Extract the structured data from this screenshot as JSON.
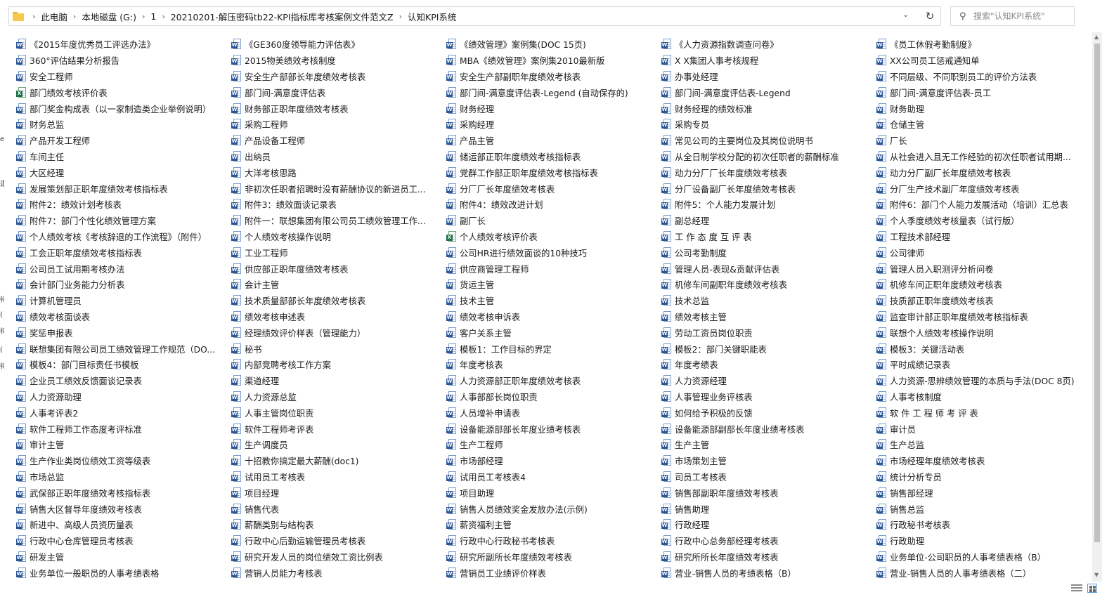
{
  "breadcrumb": [
    "此电脑",
    "本地磁盘 (G:)",
    "1",
    "20210201-解压密码tb22-KPI指标库考核案例文件范文Z",
    "认知KPI系统"
  ],
  "search": {
    "placeholder": "搜索\"认知KPI系统\""
  },
  "icons": {
    "folder": "folder-icon",
    "refresh": "refresh-icon",
    "search": "search-icon",
    "chevron": "chevron-down-icon"
  },
  "colors": {
    "word": "#2b5797",
    "excel": "#1e7145",
    "folder": "#f5c94e"
  },
  "left_strip": [
    "e",
    "退",
    "待",
    "(",
    "待",
    "(",
    "待"
  ],
  "files": [
    {
      "name": "《2015年度优秀员工评选办法》",
      "type": "doc"
    },
    {
      "name": "《GE360度领导能力评估表》",
      "type": "doc"
    },
    {
      "name": "《绩效管理》案例集(DOC 15页)",
      "type": "doc"
    },
    {
      "name": "《人力资源指数调查问卷》",
      "type": "doc"
    },
    {
      "name": "《员工休假考勤制度》",
      "type": "doc"
    },
    {
      "name": "360°评估结果分析报告",
      "type": "doc"
    },
    {
      "name": "2015物美绩效考核制度",
      "type": "doc"
    },
    {
      "name": "MBA《绩效管理》案例集2010最新版",
      "type": "doc"
    },
    {
      "name": "X X集团人事考核规程",
      "type": "doc"
    },
    {
      "name": "XX公司员工惩戒通知单",
      "type": "doc"
    },
    {
      "name": "安全工程师",
      "type": "doc"
    },
    {
      "name": "安全生产部部长年度绩效考核表",
      "type": "doc"
    },
    {
      "name": "安全生产部副职年度绩效考核表",
      "type": "doc"
    },
    {
      "name": "办事处经理",
      "type": "doc"
    },
    {
      "name": "不同层级、不同职别员工的评价方法表",
      "type": "doc"
    },
    {
      "name": "部门绩效考核评价表",
      "type": "xls"
    },
    {
      "name": "部门间-满意度评估表",
      "type": "doc"
    },
    {
      "name": "部门间-满意度评估表-Legend (自动保存的)",
      "type": "doc"
    },
    {
      "name": "部门间-满意度评估表-Legend",
      "type": "doc"
    },
    {
      "name": "部门间-满意度评估表-员工",
      "type": "doc"
    },
    {
      "name": "部门奖金构成表（以一家制造类企业举例说明）",
      "type": "doc"
    },
    {
      "name": "财务部正职年度绩效考核表",
      "type": "doc"
    },
    {
      "name": "财务经理",
      "type": "doc"
    },
    {
      "name": "财务经理的绩效标准",
      "type": "doc"
    },
    {
      "name": "财务助理",
      "type": "doc"
    },
    {
      "name": "财务总监",
      "type": "doc"
    },
    {
      "name": "采购工程师",
      "type": "doc"
    },
    {
      "name": "采购经理",
      "type": "doc"
    },
    {
      "name": "采购专员",
      "type": "doc"
    },
    {
      "name": "仓储主管",
      "type": "doc"
    },
    {
      "name": "产品开发工程师",
      "type": "doc"
    },
    {
      "name": "产品设备工程师",
      "type": "doc"
    },
    {
      "name": "产品主管",
      "type": "doc"
    },
    {
      "name": "常见公司的主要岗位及其岗位说明书",
      "type": "doc"
    },
    {
      "name": "厂长",
      "type": "doc"
    },
    {
      "name": "车间主任",
      "type": "doc"
    },
    {
      "name": "出纳员",
      "type": "doc"
    },
    {
      "name": "储运部正职年度绩效考核指标表",
      "type": "doc"
    },
    {
      "name": "从全日制学校分配的初次任职者的薪酬标准",
      "type": "doc"
    },
    {
      "name": "从社会进入且无工作经验的初次任职者试用期...",
      "type": "doc"
    },
    {
      "name": "大区经理",
      "type": "doc"
    },
    {
      "name": "大洋考核思路",
      "type": "doc"
    },
    {
      "name": "党群工作部正职年度绩效考核指标表",
      "type": "doc"
    },
    {
      "name": "动力分厂厂长年度绩效考核表",
      "type": "doc"
    },
    {
      "name": "动力分厂副厂长年度绩效考核表",
      "type": "doc"
    },
    {
      "name": "发展策划部正职年度绩效考核指标表",
      "type": "doc"
    },
    {
      "name": "非初次任职者招聘时没有薪酬协议的新进员工...",
      "type": "doc"
    },
    {
      "name": "分厂厂长年度绩效考核表",
      "type": "doc"
    },
    {
      "name": "分厂设备副厂长年度绩效考核表",
      "type": "doc"
    },
    {
      "name": "分厂生产技术副厂年度绩效考核表",
      "type": "doc"
    },
    {
      "name": "附件2：绩效计划考核表",
      "type": "doc"
    },
    {
      "name": "附件3：绩效面谈记录表",
      "type": "doc"
    },
    {
      "name": "附件4：绩效改进计划",
      "type": "doc"
    },
    {
      "name": "附件5：个人能力发展计划",
      "type": "doc"
    },
    {
      "name": "附件6：部门个人能力发展活动（培训）汇总表",
      "type": "doc"
    },
    {
      "name": "附件7：部门个性化绩效管理方案",
      "type": "doc"
    },
    {
      "name": "附件一：联想集团有限公司员工绩效管理工作...",
      "type": "doc"
    },
    {
      "name": "副厂长",
      "type": "doc"
    },
    {
      "name": "副总经理",
      "type": "doc"
    },
    {
      "name": "个人季度绩效考核量表（试行版）",
      "type": "doc"
    },
    {
      "name": "个人绩效考核《考核辞退的工作流程》（附件）",
      "type": "doc"
    },
    {
      "name": "个人绩效考核操作说明",
      "type": "doc"
    },
    {
      "name": "个人绩效考核评价表",
      "type": "xls"
    },
    {
      "name": "工 作 态 度 互 评 表",
      "type": "doc"
    },
    {
      "name": "工程技术部经理",
      "type": "doc"
    },
    {
      "name": "工会正职年度绩效考核指标表",
      "type": "doc"
    },
    {
      "name": "工业工程师",
      "type": "doc"
    },
    {
      "name": "公司HR进行绩效面谈的10种技巧",
      "type": "doc"
    },
    {
      "name": "公司考勤制度",
      "type": "doc"
    },
    {
      "name": "公司律师",
      "type": "doc"
    },
    {
      "name": "公司员工试用期考核办法",
      "type": "doc"
    },
    {
      "name": "供应部正职年度绩效考核表",
      "type": "doc"
    },
    {
      "name": "供应商管理工程师",
      "type": "doc"
    },
    {
      "name": "管理人员-表现&贡献评估表",
      "type": "doc"
    },
    {
      "name": "管理人员入职测评分析问卷",
      "type": "doc"
    },
    {
      "name": "会计部门业务能力分析表",
      "type": "doc"
    },
    {
      "name": "会计主管",
      "type": "doc"
    },
    {
      "name": "货运主管",
      "type": "doc"
    },
    {
      "name": "机修车间副职年度绩效考核表",
      "type": "doc"
    },
    {
      "name": "机修车间正职年度绩效考核表",
      "type": "doc"
    },
    {
      "name": "计算机管理员",
      "type": "doc"
    },
    {
      "name": "技术质量部部长年度绩效考核表",
      "type": "doc"
    },
    {
      "name": "技术主管",
      "type": "doc"
    },
    {
      "name": "技术总监",
      "type": "doc"
    },
    {
      "name": "技质部正职年度绩效考核表",
      "type": "doc"
    },
    {
      "name": "绩效考核面谈表",
      "type": "doc"
    },
    {
      "name": "绩效考核申述表",
      "type": "doc"
    },
    {
      "name": "绩效考核申诉表",
      "type": "doc"
    },
    {
      "name": "绩效考核主管",
      "type": "doc"
    },
    {
      "name": "监查审计部正职年度绩效考核指标表",
      "type": "doc"
    },
    {
      "name": "奖惩申报表",
      "type": "doc"
    },
    {
      "name": "经理绩效评价样表（管理能力）",
      "type": "doc"
    },
    {
      "name": "客户关系主管",
      "type": "doc"
    },
    {
      "name": "劳动工资员岗位职责",
      "type": "doc"
    },
    {
      "name": "联想个人绩效考核操作说明",
      "type": "doc"
    },
    {
      "name": "联想集团有限公司员工绩效管理工作规范（DO...",
      "type": "doc"
    },
    {
      "name": "秘书",
      "type": "doc"
    },
    {
      "name": "模板1：工作目标的界定",
      "type": "doc"
    },
    {
      "name": "模板2：部门关键职能表",
      "type": "doc"
    },
    {
      "name": "模板3：关键活动表",
      "type": "doc"
    },
    {
      "name": "模板4：部门目标责任书模板",
      "type": "doc"
    },
    {
      "name": "内部竞聘考核工作方案",
      "type": "doc"
    },
    {
      "name": "年度考核表",
      "type": "doc"
    },
    {
      "name": "年度考绩表",
      "type": "doc"
    },
    {
      "name": "平时成绩记录表",
      "type": "doc"
    },
    {
      "name": "企业员工绩效反馈面谈记录表",
      "type": "doc"
    },
    {
      "name": "渠道经理",
      "type": "doc"
    },
    {
      "name": "人力资源部正职年度绩效考核表",
      "type": "doc"
    },
    {
      "name": "人力资源经理",
      "type": "doc"
    },
    {
      "name": "人力资源-思辨绩效管理的本质与手法(DOC 8页)",
      "type": "doc"
    },
    {
      "name": "人力资源助理",
      "type": "doc"
    },
    {
      "name": "人力资源总监",
      "type": "doc"
    },
    {
      "name": "人事部部长岗位职责",
      "type": "doc"
    },
    {
      "name": "人事管理业务评核表",
      "type": "doc"
    },
    {
      "name": "人事考核制度",
      "type": "doc"
    },
    {
      "name": "人事考评表2",
      "type": "doc"
    },
    {
      "name": "人事主管岗位职责",
      "type": "doc"
    },
    {
      "name": "人员增补申请表",
      "type": "doc"
    },
    {
      "name": "如何给予积极的反馈",
      "type": "doc"
    },
    {
      "name": "软 件 工 程 师 考 评 表",
      "type": "doc"
    },
    {
      "name": "软件工程师工作态度考评标准",
      "type": "doc"
    },
    {
      "name": "软件工程师考评表",
      "type": "doc"
    },
    {
      "name": "设备能源部部长年度业绩考核表",
      "type": "doc"
    },
    {
      "name": "设备能源部副部长年度业绩考核表",
      "type": "doc"
    },
    {
      "name": "审计员",
      "type": "doc"
    },
    {
      "name": "审计主管",
      "type": "doc"
    },
    {
      "name": "生产调度员",
      "type": "doc"
    },
    {
      "name": "生产工程师",
      "type": "doc"
    },
    {
      "name": "生产主管",
      "type": "doc"
    },
    {
      "name": "生产总监",
      "type": "doc"
    },
    {
      "name": "生产作业类岗位绩效工资等级表",
      "type": "doc"
    },
    {
      "name": "十招教你搞定最大薪酬(doc1)",
      "type": "doc"
    },
    {
      "name": "市场部经理",
      "type": "doc"
    },
    {
      "name": "市场策划主管",
      "type": "doc"
    },
    {
      "name": "市场经理年度绩效考核表",
      "type": "doc"
    },
    {
      "name": "市场总监",
      "type": "doc"
    },
    {
      "name": "试用员工考核表",
      "type": "doc"
    },
    {
      "name": "试用员工考核表4",
      "type": "doc"
    },
    {
      "name": "司员工考核表",
      "type": "doc"
    },
    {
      "name": "统计分析专员",
      "type": "doc"
    },
    {
      "name": "武保部正职年度绩效考核指标表",
      "type": "doc"
    },
    {
      "name": "项目经理",
      "type": "doc"
    },
    {
      "name": "项目助理",
      "type": "doc"
    },
    {
      "name": "销售部副职年度绩效考核表",
      "type": "doc"
    },
    {
      "name": "销售部经理",
      "type": "doc"
    },
    {
      "name": "销售大区督导年度绩效考核表",
      "type": "doc"
    },
    {
      "name": "销售代表",
      "type": "doc"
    },
    {
      "name": "销售人员绩效奖金发放办法(示例)",
      "type": "doc"
    },
    {
      "name": "销售助理",
      "type": "doc"
    },
    {
      "name": "销售总监",
      "type": "doc"
    },
    {
      "name": "新进中、高级人员资历量表",
      "type": "doc"
    },
    {
      "name": "薪酬类别与结构表",
      "type": "doc"
    },
    {
      "name": "薪资福利主管",
      "type": "doc"
    },
    {
      "name": "行政经理",
      "type": "doc"
    },
    {
      "name": "行政秘书考核表",
      "type": "doc"
    },
    {
      "name": "行政中心仓库管理员考核表",
      "type": "doc"
    },
    {
      "name": "行政中心后勤运输管理员考核表",
      "type": "doc"
    },
    {
      "name": "行政中心行政秘书考核表",
      "type": "doc"
    },
    {
      "name": "行政中心总务部经理考核表",
      "type": "doc"
    },
    {
      "name": "行政助理",
      "type": "doc"
    },
    {
      "name": "研发主管",
      "type": "doc"
    },
    {
      "name": "研究开发人员的岗位绩效工资比例表",
      "type": "doc"
    },
    {
      "name": "研究所副所长年度绩效考核表",
      "type": "doc"
    },
    {
      "name": "研究所所长年度绩效考核表",
      "type": "doc"
    },
    {
      "name": "业务单位-公司职员的人事考绩表格（B）",
      "type": "doc"
    },
    {
      "name": "业务单位一般职员的人事考绩表格",
      "type": "doc"
    },
    {
      "name": "营销人员能力考核表",
      "type": "doc"
    },
    {
      "name": "营销员工业绩评价样表",
      "type": "doc"
    },
    {
      "name": "营业-销售人员的考绩表格（B）",
      "type": "doc"
    },
    {
      "name": "营业-销售人员的人事考绩表格（二）",
      "type": "doc"
    }
  ]
}
